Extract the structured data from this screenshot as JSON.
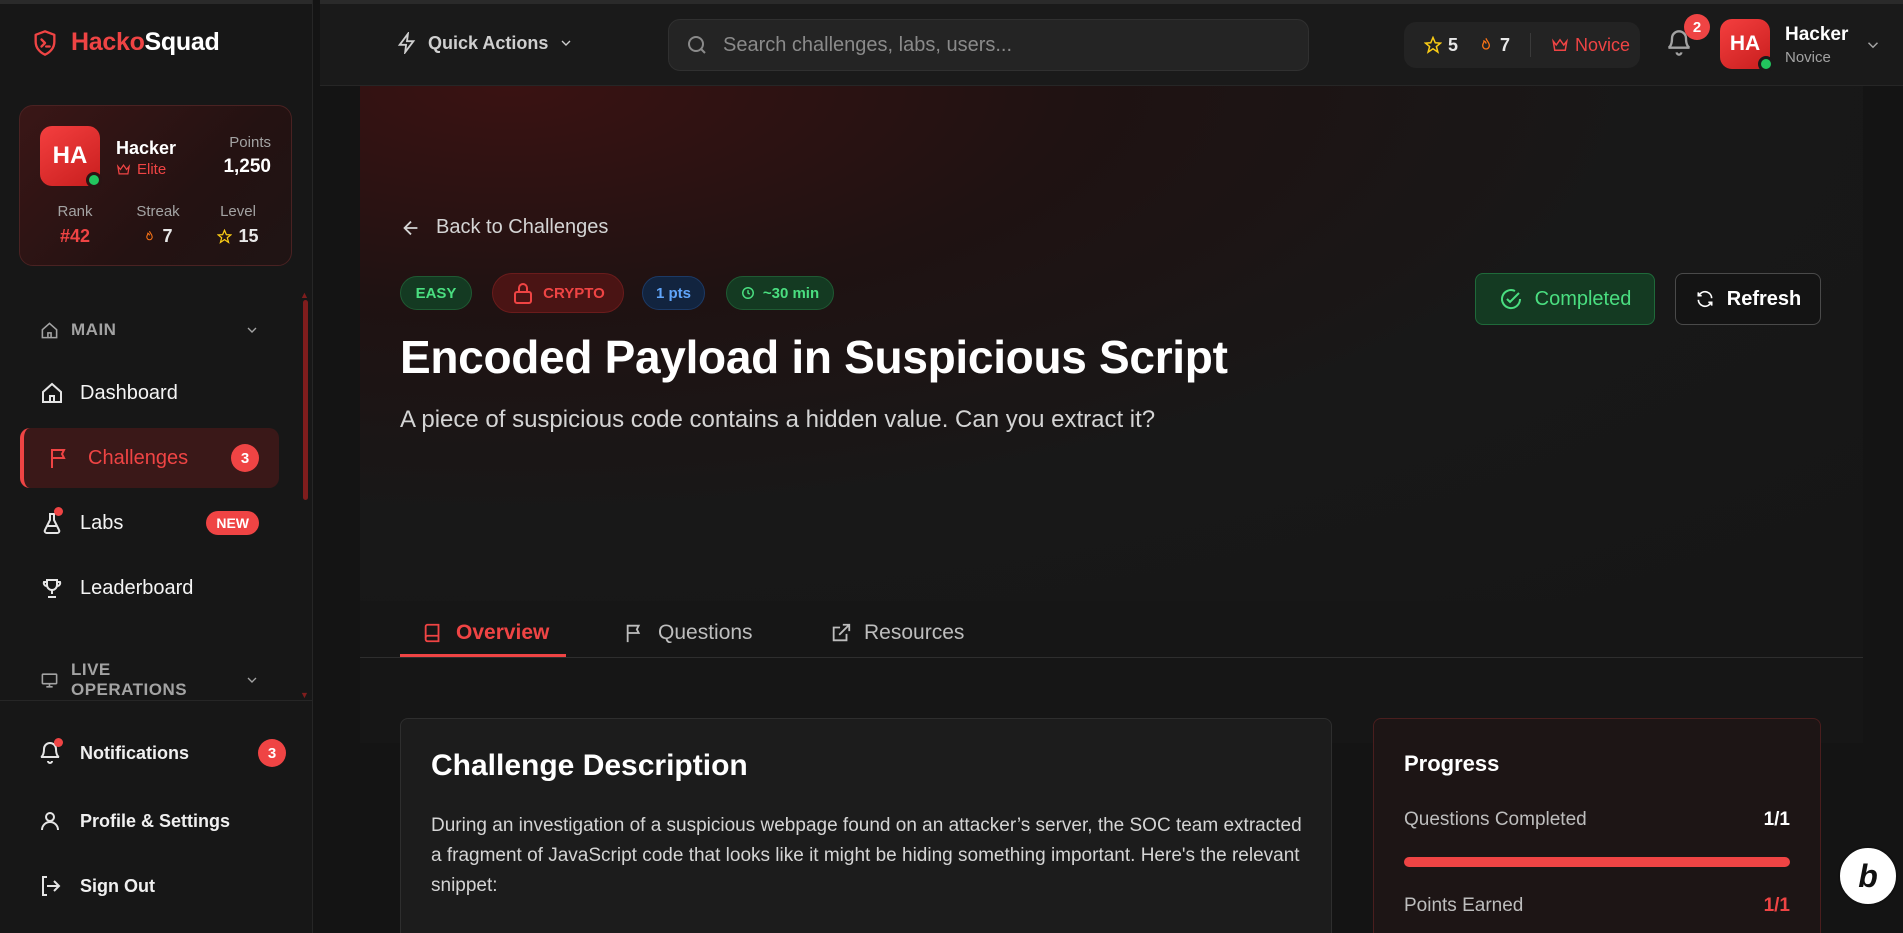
{
  "brand": {
    "part1": "Hacko",
    "part2": "Squad"
  },
  "user_card": {
    "initials": "HA",
    "name": "Hacker",
    "tier": "Elite",
    "points_label": "Points",
    "points_value": "1,250",
    "rank_label": "Rank",
    "rank_value": "#42",
    "streak_label": "Streak",
    "streak_value": "7",
    "level_label": "Level",
    "level_value": "15"
  },
  "sidebar": {
    "main_section": "MAIN",
    "items": [
      {
        "label": "Dashboard"
      },
      {
        "label": "Challenges",
        "badge": "3"
      },
      {
        "label": "Labs",
        "badge": "NEW"
      },
      {
        "label": "Leaderboard"
      }
    ],
    "live_section": "LIVE OPERATIONS",
    "bottom": [
      {
        "label": "Notifications",
        "badge": "3"
      },
      {
        "label": "Profile & Settings"
      },
      {
        "label": "Sign Out"
      }
    ]
  },
  "topbar": {
    "quick_actions": "Quick Actions",
    "search_placeholder": "Search challenges, labs, users...",
    "stars": "5",
    "streak": "7",
    "rank": "Novice",
    "notif_count": "2",
    "avatar_initials": "HA",
    "user_name": "Hacker",
    "user_role": "Novice"
  },
  "challenge": {
    "back_label": "Back to Challenges",
    "difficulty": "EASY",
    "category": "CRYPTO",
    "points": "1 pts",
    "time": "~30 min",
    "title": "Encoded Payload in Suspicious Script",
    "subtitle": "A piece of suspicious code contains a hidden value. Can you extract it?",
    "status_label": "Completed",
    "refresh_label": "Refresh"
  },
  "tabs": [
    {
      "label": "Overview"
    },
    {
      "label": "Questions"
    },
    {
      "label": "Resources"
    }
  ],
  "description": {
    "heading": "Challenge Description",
    "body": "During an investigation of a suspicious webpage found on an attacker’s server, the SOC team extracted a fragment of JavaScript code that looks like it might be hiding something important. Here's the relevant snippet:"
  },
  "progress": {
    "heading": "Progress",
    "questions_label": "Questions Completed",
    "questions_value": "1/1",
    "questions_fraction": 1.0,
    "points_label": "Points Earned",
    "points_value": "1/1"
  },
  "colors": {
    "accent": "#ef4444",
    "success": "#4ade80",
    "info": "#60a5fa"
  },
  "icons": {
    "logo": "shield-terminal-icon",
    "quick": "lightning-icon",
    "search": "search-icon",
    "bell": "bell-icon"
  }
}
